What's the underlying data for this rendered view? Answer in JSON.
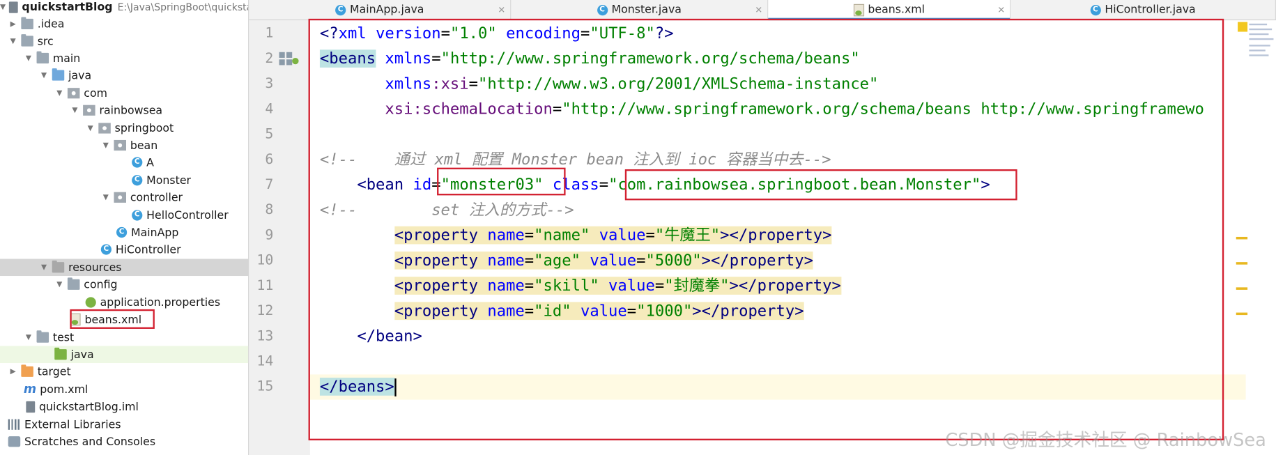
{
  "project": {
    "root_name": "quickstartBlog",
    "root_path": "E:\\Java\\SpringBoot\\quickstar",
    "nodes": [
      ".idea",
      "src",
      "main",
      "java",
      "com",
      "rainbowsea",
      "springboot",
      "bean",
      "A",
      "Monster",
      "controller",
      "HelloController",
      "MainApp",
      "HiController",
      "resources",
      "config",
      "application.properties",
      "beans.xml",
      "test",
      "java",
      "target",
      "pom.xml",
      "quickstartBlog.iml",
      "External Libraries",
      "Scratches and Consoles"
    ]
  },
  "tabs": [
    "MainApp.java",
    "Monster.java",
    "beans.xml",
    "HiController.java"
  ],
  "editor": {
    "line_numbers": [
      "1",
      "2",
      "3",
      "4",
      "5",
      "6",
      "7",
      "8",
      "9",
      "10",
      "11",
      "12",
      "13",
      "14",
      "15"
    ],
    "l1": {
      "a": "<?",
      "b": "xml ",
      "c": "version",
      "d": "=",
      "e": "\"1.0\"",
      "f": " ",
      "g": "encoding",
      "h": "=",
      "i": "\"UTF-8\"",
      "j": "?>"
    },
    "l2": {
      "a": "<beans",
      "b": " ",
      "c": "xmlns",
      "d": "=",
      "e": "\"http://www.springframework.org/schema/beans\""
    },
    "l3": {
      "a": "       ",
      "b": "xmlns",
      "c": ":xsi",
      "d": "=",
      "e": "\"http://www.w3.org/2001/XMLSchema-instance\""
    },
    "l4": {
      "a": "       ",
      "b": "xsi",
      "c": ":schemaLocation",
      "d": "=",
      "e": "\"http://www.springframework.org/schema/beans http://www.springframewo"
    },
    "l6": "<!--    通过 xml 配置 Monster bean 注入到 ioc 容器当中去-->",
    "l7": {
      "a": "    ",
      "b": "<bean ",
      "c": "id",
      "d": "=",
      "e": "\"monster03\"",
      "f": " ",
      "g": "class",
      "h": "=",
      "i": "\"com.rainbowsea.springboot.bean.Monster\"",
      "j": ">"
    },
    "l8": "<!--        set 注入的方式-->",
    "props": [
      {
        "name": "\"name\"",
        "value": "\"牛魔王\""
      },
      {
        "name": "\"age\"",
        "value": "\"5000\""
      },
      {
        "name": "\"skill\"",
        "value": "\"封魔拳\""
      },
      {
        "name": "\"id\"",
        "value": "\"1000\""
      }
    ],
    "prop_tokens": {
      "open": "<property",
      "name_attr": "name",
      "eq": "=",
      "value_attr": "value",
      "close": "></property>"
    },
    "l13": {
      "a": "    ",
      "b": "</bean>"
    },
    "l15": "</beans>"
  },
  "watermark": "CSDN @掘金技术社区 @ RainbowSea",
  "colors": {
    "tag": "#000080",
    "attr": "#0000ff",
    "string": "#008000",
    "comment": "#8c8c8c",
    "highlight": "#f6ebbc",
    "red_box": "#d32030"
  }
}
